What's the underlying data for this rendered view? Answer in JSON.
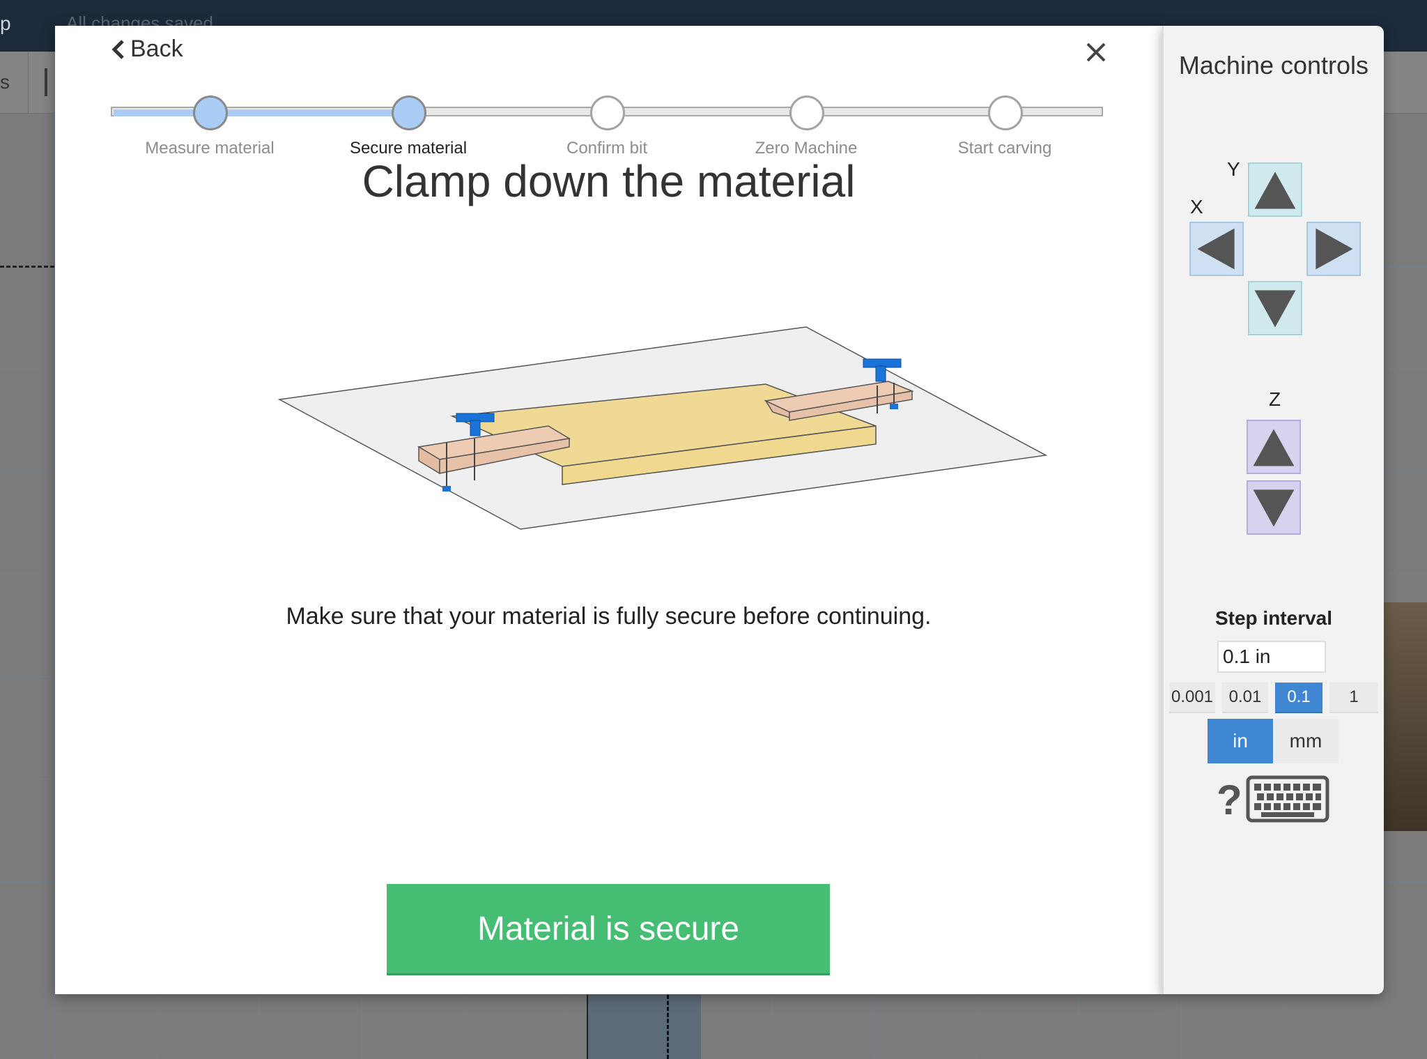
{
  "app": {
    "save_status": "All changes saved",
    "topbar_glyph": "p",
    "toolbar_glyph": "s"
  },
  "modal": {
    "back_label": "Back",
    "close_icon": "close-icon",
    "steps": [
      {
        "label": "Measure material",
        "state": "done"
      },
      {
        "label": "Secure material",
        "state": "active"
      },
      {
        "label": "Confirm bit",
        "state": "todo"
      },
      {
        "label": "Zero Machine",
        "state": "todo"
      },
      {
        "label": "Start carving",
        "state": "todo"
      }
    ],
    "title": "Clamp down the material",
    "instructions": "Make sure that your material is fully secure before continuing.",
    "primary_button": "Material is secure",
    "colors": {
      "step_fill": "#a9cdf5",
      "primary": "#45bd72",
      "clamp": "#1a73d9",
      "wood": "#efd995",
      "clamp_bar": "#eecbb3"
    }
  },
  "machine_controls": {
    "title": "Machine controls",
    "axis_y": "Y",
    "axis_x": "X",
    "axis_z": "Z",
    "step_interval_title": "Step interval",
    "step_interval_value": "0.1 in",
    "step_options": [
      "0.001",
      "0.01",
      "0.1",
      "1"
    ],
    "selected_step": "0.1",
    "units": [
      "in",
      "mm"
    ],
    "selected_unit": "in",
    "help_label": "?",
    "keyboard_icon": "keyboard-icon"
  }
}
